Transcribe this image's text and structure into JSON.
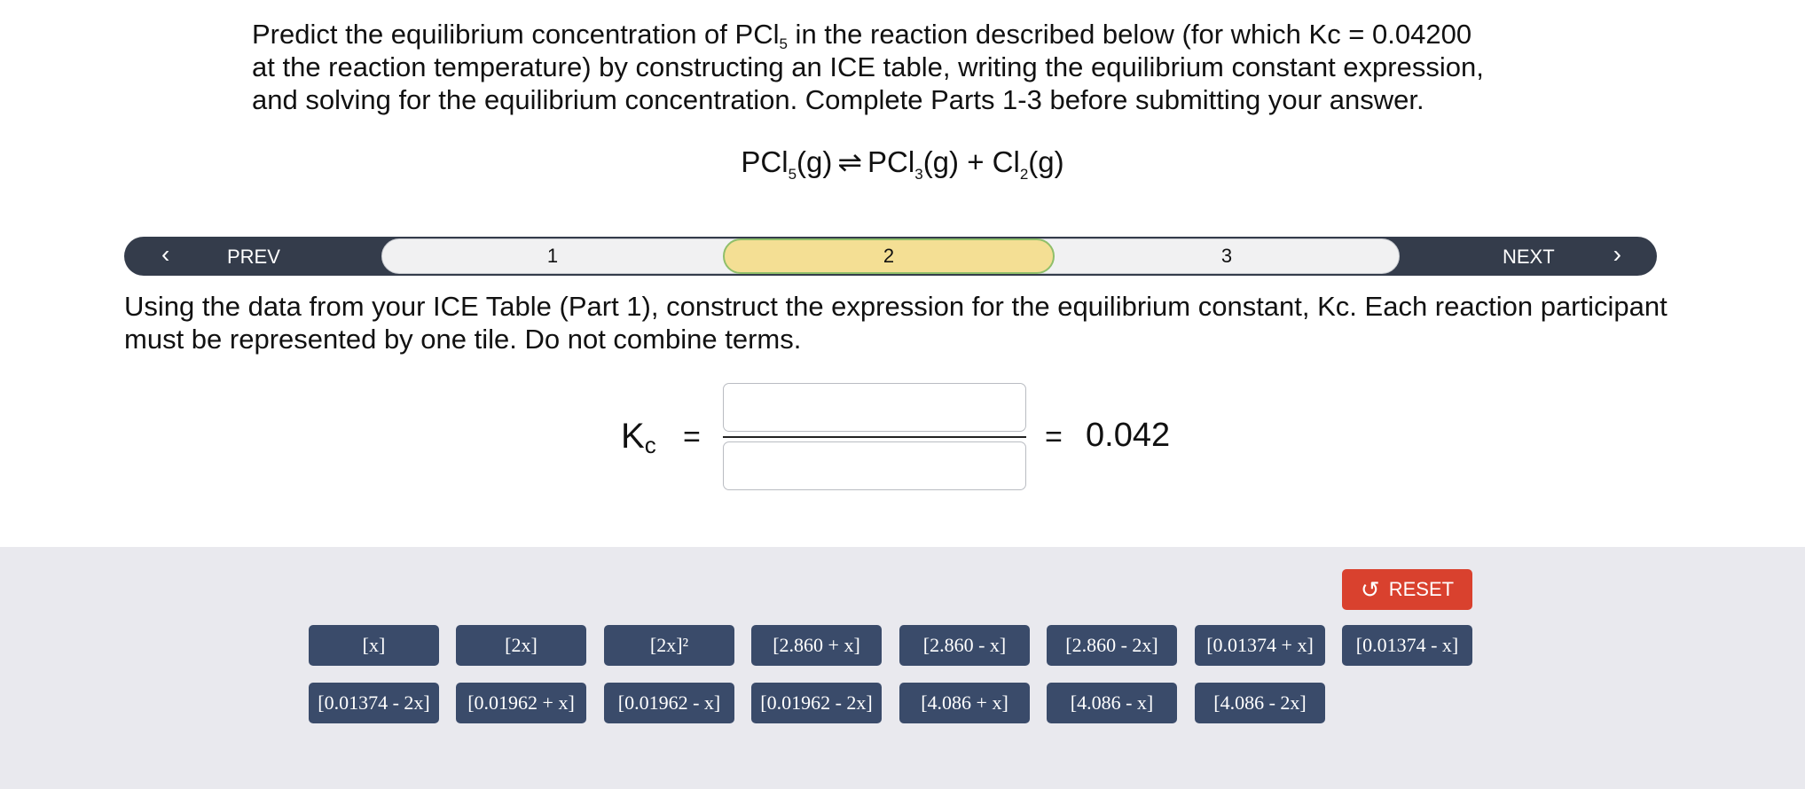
{
  "question": {
    "p1": "Predict the equilibrium concentration of PCl",
    "p1_sub": "5",
    "p2": " in the reaction described below (for which Kc = 0.04200",
    "line2": "at the reaction temperature) by constructing an ICE table, writing the equilibrium constant expression,",
    "line3": "and solving for the equilibrium concentration. Complete Parts 1-3 before submitting your answer."
  },
  "equation": {
    "reactant": "PCl",
    "reactant_sub": "5",
    "reactant_state": "(g)",
    "arrow": "⇌",
    "product1": "PCl",
    "product1_sub": "3",
    "product1_state": "(g) + ",
    "product2": "Cl",
    "product2_sub": "2",
    "product2_state": "(g)"
  },
  "stepper": {
    "prev": "PREV",
    "next": "NEXT",
    "steps": [
      "1",
      "2",
      "3"
    ],
    "active": "2"
  },
  "instruction": "Using the data from your ICE Table (Part 1), construct the expression for the equilibrium constant, Kc. Each reaction participant must be represented by one tile. Do not combine terms.",
  "kc": {
    "label": "K",
    "label_sub": "c",
    "equals": "=",
    "value": "0.042"
  },
  "reset_label": "RESET",
  "tiles": [
    "[x]",
    "[2x]",
    "[2x]²",
    "[2.860 + x]",
    "[2.860 - x]",
    "[2.860 - 2x]",
    "[0.01374 + x]",
    "[0.01374 - x]",
    "[0.01374 - 2x]",
    "[0.01962 + x]",
    "[0.01962 - x]",
    "[0.01962 - 2x]",
    "[4.086 + x]",
    "[4.086 - x]",
    "[4.086 - 2x]"
  ]
}
